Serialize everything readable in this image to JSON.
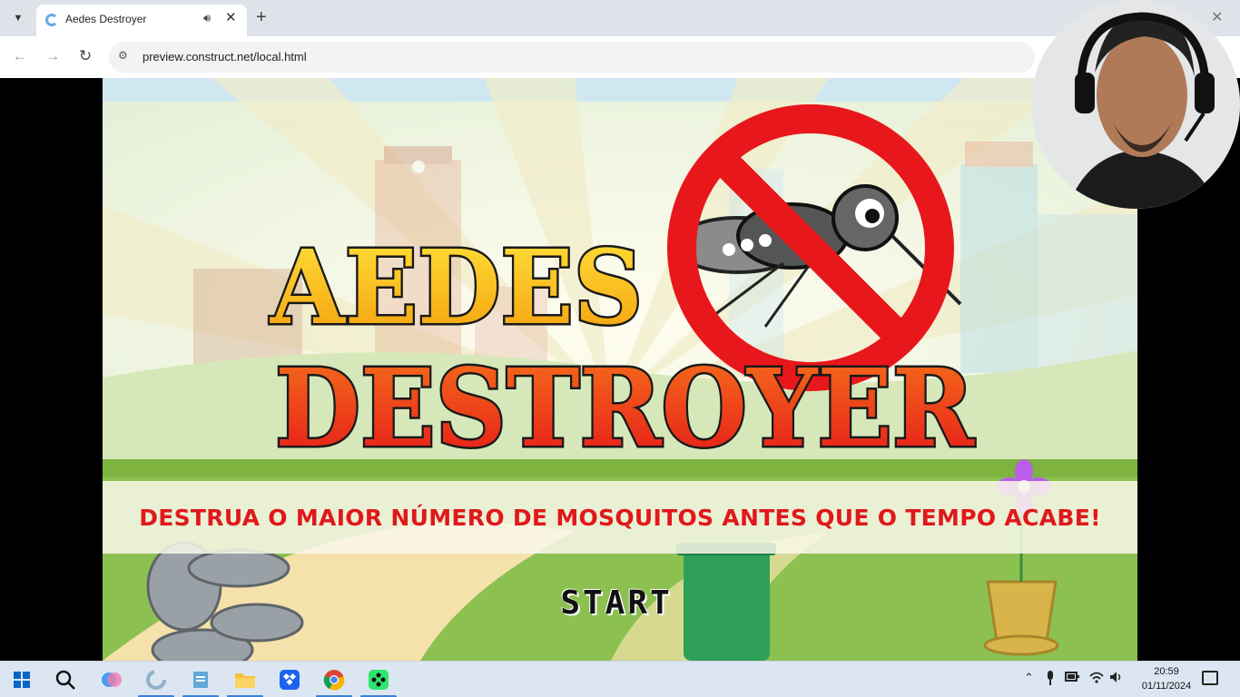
{
  "browser": {
    "tab": {
      "title": "Aedes Destroyer"
    },
    "address_bar": {
      "url": "preview.construct.net/local.html"
    }
  },
  "game": {
    "title_line1": "AEDES",
    "title_line2": "DESTROYER",
    "instructions": "DESTRUA O MAIOR NÚMERO DE MOSQUITOS ANTES QUE O TEMPO ACABE!",
    "start_label": "START",
    "colors": {
      "title_top": "#f6c20d",
      "title_bottom": "#e6331a",
      "instruction_text": "#e0181b",
      "no_sign": "#e8171b"
    }
  },
  "taskbar": {
    "items": [
      "start",
      "search",
      "copilot",
      "construct",
      "notepad",
      "file-explorer",
      "dropbox",
      "chrome",
      "gamepad-app"
    ],
    "clock": {
      "time": "20:59",
      "date": "01/11/2024"
    }
  }
}
